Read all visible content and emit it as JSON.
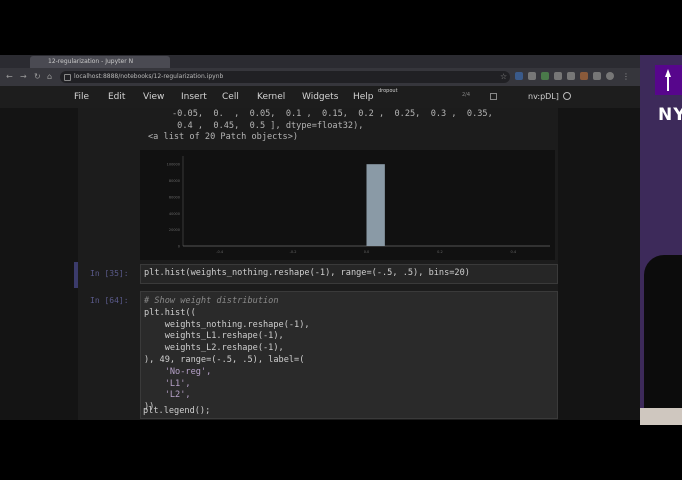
{
  "browser": {
    "tab_title": "12-regularization - Jupyter N",
    "url": "localhost:8888/notebooks/12-regularization.ipynb"
  },
  "menu": [
    "File",
    "Edit",
    "View",
    "Insert",
    "Cell",
    "Kernel",
    "Widgets",
    "Help"
  ],
  "toolbar": {
    "dropout_label": "dropout",
    "kernel_label": "nv:pDL]",
    "status_small": "2/4"
  },
  "output": {
    "line1": "-0.05,  0.  ,  0.05,  0.1 ,  0.15,  0.2 ,  0.25,  0.3 ,  0.35,",
    "line2": " 0.4 ,  0.45,  0.5 ], dtype=float32),",
    "line3": "<a list of 20 Patch objects>)"
  },
  "chart_data": {
    "type": "bar",
    "x": [
      -0.5,
      -0.45,
      -0.4,
      -0.35,
      -0.3,
      -0.25,
      -0.2,
      -0.15,
      -0.1,
      -0.05,
      0.0,
      0.05,
      0.1,
      0.15,
      0.2,
      0.25,
      0.3,
      0.35,
      0.4,
      0.45
    ],
    "values": [
      0,
      0,
      0,
      0,
      0,
      0,
      0,
      0,
      0,
      0,
      100000,
      0,
      0,
      0,
      0,
      0,
      0,
      0,
      0,
      0
    ],
    "xticks": [
      "-0.4",
      "-0.2",
      "0.0",
      "0.2",
      "0.4"
    ],
    "yticks": [
      "0",
      "20000",
      "40000",
      "60000",
      "80000",
      "100000"
    ],
    "xlim": [
      -0.5,
      0.5
    ],
    "ylim": [
      0,
      110000
    ],
    "bar_color": "#8a9aa6",
    "grid": false
  },
  "cells": {
    "in35_prompt": "In [35]:",
    "in35_code": "plt.hist(weights_nothing.reshape(-1), range=(-.5, .5), bins=20)",
    "in64_prompt": "In [64]:",
    "in64_comment": "# Show weight distribution",
    "in64_lines": [
      "plt.hist((",
      "    weights_nothing.reshape(-1),",
      "    weights_L1.reshape(-1),",
      "    weights_L2.reshape(-1),",
      "), 49, range=(-.5, .5), label=(",
      "    'No-reg',",
      "    'L1',",
      "    'L2',",
      "))",
      "plt.legend();"
    ]
  },
  "brand": {
    "text": "NY",
    "color": "#57068c"
  }
}
